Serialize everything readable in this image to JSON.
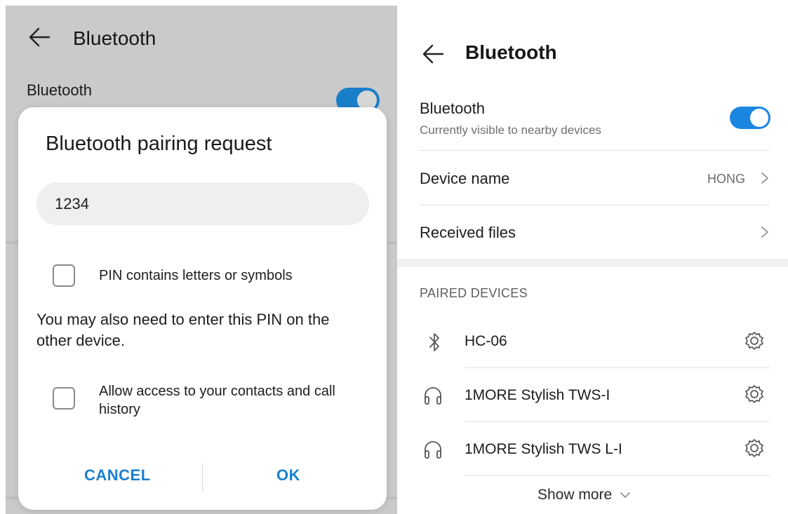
{
  "left_screen": {
    "header": {
      "title": "Bluetooth"
    },
    "bluetooth_row": {
      "label": "Bluetooth",
      "toggle_on": true
    },
    "dialog": {
      "title": "Bluetooth pairing request",
      "pin_value": "1234",
      "pin_checkbox_label": "PIN contains letters or symbols",
      "info_text": "You may also need to enter this PIN on the other device.",
      "contacts_checkbox_label": "Allow access to your contacts and call history",
      "cancel_label": "CANCEL",
      "ok_label": "OK"
    }
  },
  "right_screen": {
    "header": {
      "title": "Bluetooth"
    },
    "bluetooth_row": {
      "label": "Bluetooth",
      "subtitle": "Currently visible to nearby devices",
      "toggle_on": true
    },
    "device_name_row": {
      "label": "Device name",
      "value": "HONG"
    },
    "received_files_row": {
      "label": "Received files"
    },
    "paired_section": {
      "title": "PAIRED DEVICES",
      "devices": [
        {
          "name": "HC-06",
          "icon": "bluetooth-icon"
        },
        {
          "name": "1MORE Stylish TWS-I",
          "icon": "headphones-icon"
        },
        {
          "name": "1MORE Stylish TWS L-I",
          "icon": "headphones-icon"
        }
      ],
      "show_more_label": "Show more"
    }
  },
  "colors": {
    "accent": "#1a7fd0",
    "toggle_active": "#1a86e0"
  }
}
